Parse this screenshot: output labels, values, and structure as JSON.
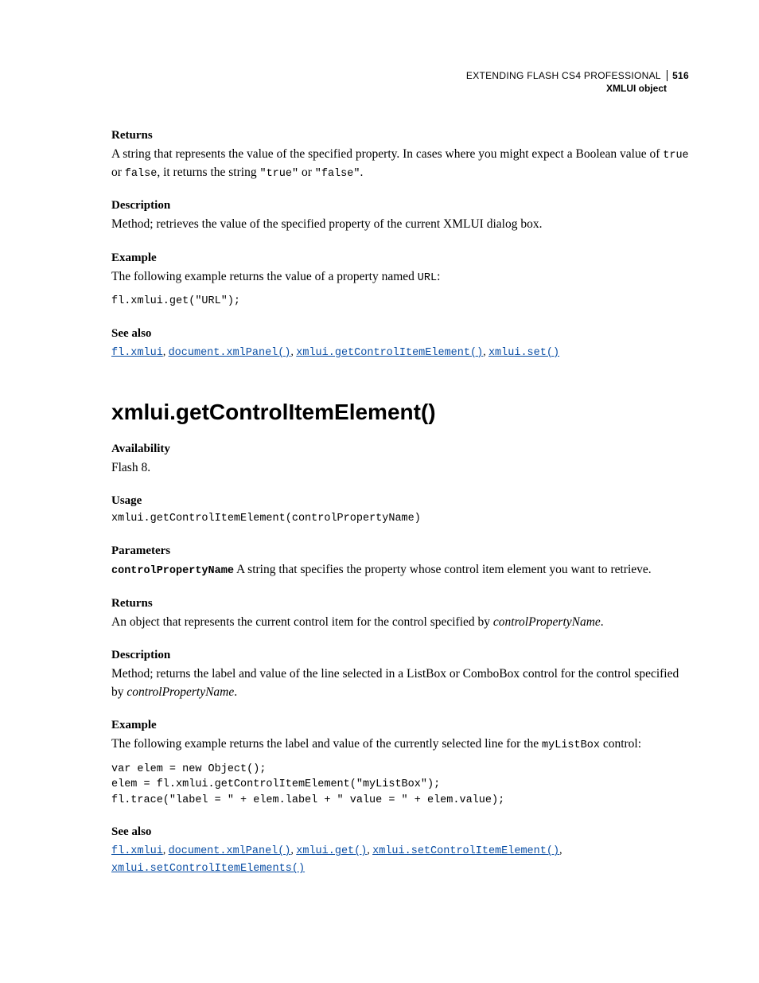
{
  "header": {
    "title_upper": "EXTENDING FLASH CS4 PROFESSIONAL",
    "page_number": "516",
    "subtitle": "XMLUI object"
  },
  "section1": {
    "returns_label": "Returns",
    "returns_text_a": "A string that represents the value of the specified property. In cases where you might expect a Boolean value of ",
    "returns_code_true": "true",
    "returns_text_b": " or ",
    "returns_code_false": "false",
    "returns_text_c": ", it returns the string ",
    "returns_code_qtrue": "\"true\"",
    "returns_text_d": " or ",
    "returns_code_qfalse": "\"false\"",
    "returns_text_e": ".",
    "description_label": "Description",
    "description_text": "Method; retrieves the value of the specified property of the current XMLUI dialog box.",
    "example_label": "Example",
    "example_text_a": "The following example returns the value of a property named ",
    "example_code_inline": "URL",
    "example_text_b": ":",
    "example_code": "fl.xmlui.get(\"URL\");",
    "seealso_label": "See also",
    "seealso_links": {
      "l1": "fl.xmlui",
      "l2": "document.xmlPanel()",
      "l3": "xmlui.getControlItemElement()",
      "l4": "xmlui.set()"
    }
  },
  "method_title": "xmlui.getControlItemElement()",
  "section2": {
    "availability_label": "Availability",
    "availability_text": "Flash 8.",
    "usage_label": "Usage",
    "usage_code": "xmlui.getControlItemElement(controlPropertyName)",
    "parameters_label": "Parameters",
    "param_name": "controlPropertyName",
    "param_text": "  A string that specifies the property whose control item element you want to retrieve.",
    "returns_label": "Returns",
    "returns_text_a": "An object that represents the current control item for the control specified by ",
    "returns_italic": "controlPropertyName",
    "returns_text_b": ".",
    "description_label": "Description",
    "description_text_a": "Method; returns the label and value of the line selected in a ListBox or ComboBox control for the control specified by ",
    "description_italic": "controlPropertyName",
    "description_text_b": ".",
    "example_label": "Example",
    "example_text_a": "The following example returns the label and value of the currently selected line for the ",
    "example_code_inline": "myListBox",
    "example_text_b": " control:",
    "example_code": "var elem = new Object();\nelem = fl.xmlui.getControlItemElement(\"myListBox\");\nfl.trace(\"label = \" + elem.label + \" value = \" + elem.value);",
    "seealso_label": "See also",
    "seealso_links": {
      "l1": "fl.xmlui",
      "l2": "document.xmlPanel()",
      "l3": "xmlui.get()",
      "l4": "xmlui.setControlItemElement()",
      "l5": "xmlui.setControlItemElements()"
    }
  }
}
